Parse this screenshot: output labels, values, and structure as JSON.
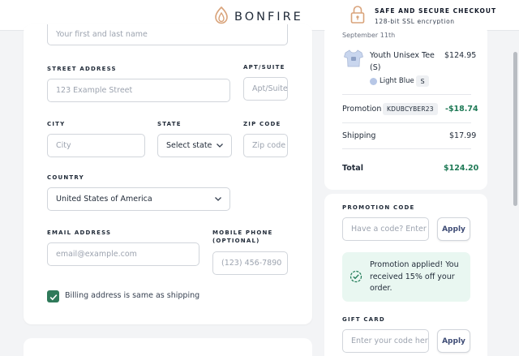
{
  "brand": {
    "name": "BONFIRE"
  },
  "secure": {
    "title": "SAFE AND SECURE CHECKOUT",
    "subtitle": "128-bit SSL encryption"
  },
  "form": {
    "name_placeholder": "Your first and last name",
    "street_label": "STREET ADDRESS",
    "street_placeholder": "123 Example Street",
    "apt_label": "APT/SUITE",
    "apt_placeholder": "Apt/Suite",
    "city_label": "CITY",
    "city_placeholder": "City",
    "state_label": "STATE",
    "state_value": "Select state",
    "zip_label": "ZIP CODE",
    "zip_placeholder": "Zip code",
    "country_label": "COUNTRY",
    "country_value": "United States of America",
    "email_label": "EMAIL ADDRESS",
    "email_placeholder": "email@example.com",
    "phone_label_1": "MOBILE PHONE",
    "phone_label_2": "(OPTIONAL)",
    "phone_placeholder": "(123) 456-7890",
    "billing_same_label": "Billing address is same as shipping",
    "billing_same_checked": true
  },
  "summary": {
    "date": "September 11th",
    "item_name_1": "Youth Unisex Tee",
    "item_name_2": "(S)",
    "item_price": "$124.95",
    "item_color": "Light Blue",
    "item_size": "S",
    "promotion_label": "Promotion",
    "promotion_code": "KDUBCYBER23",
    "promotion_amount": "-$18.74",
    "shipping_label": "Shipping",
    "shipping_amount": "$17.99",
    "total_label": "Total",
    "total_amount": "$124.20"
  },
  "promo": {
    "label": "PROMOTION CODE",
    "placeholder": "Have a code? Enter",
    "apply": "Apply",
    "success_message": "Promotion applied! You received 15% off your order.",
    "gift_label": "GIFT CARD",
    "gift_placeholder": "Enter your code her",
    "gift_apply": "Apply"
  },
  "colors": {
    "accent_green": "#1f7a56",
    "checkbox_green": "#2f7a5a",
    "success_bg": "#e9f7f1",
    "button_text": "#3c4a74",
    "logo_orange": "#d9a37a"
  },
  "icons": {
    "logo": "flame-icon",
    "lock": "lock-icon",
    "check": "check-icon",
    "success": "check-circle-icon",
    "tshirt": "tshirt-icon",
    "chevron": "chevron-down-icon"
  }
}
